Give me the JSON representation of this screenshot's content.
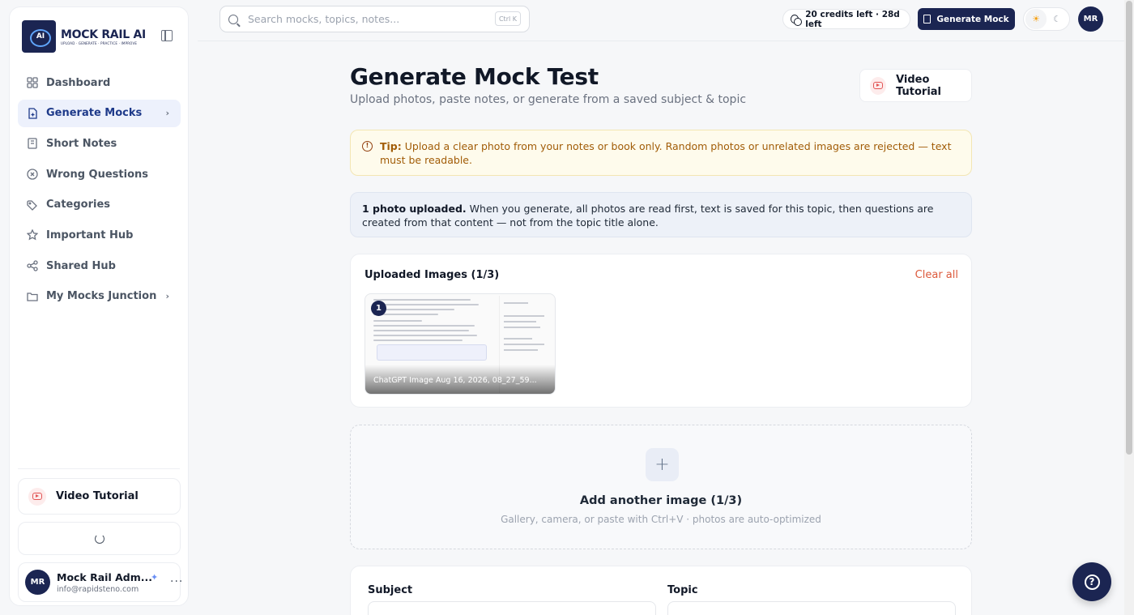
{
  "brand": {
    "title": "MOCK RAIL AI",
    "tagline": "UPLOAD · GENERATE · PRACTICE · IMPROVE"
  },
  "sidebar": {
    "items": [
      {
        "label": "Dashboard",
        "icon": "dashboard-icon"
      },
      {
        "label": "Generate Mocks",
        "icon": "file-plus-icon",
        "active": true,
        "has_chevron": true
      },
      {
        "label": "Short Notes",
        "icon": "notebook-icon"
      },
      {
        "label": "Wrong Questions",
        "icon": "x-circle-icon"
      },
      {
        "label": "Categories",
        "icon": "tags-icon"
      },
      {
        "label": "Important Hub",
        "icon": "star-icon"
      },
      {
        "label": "Shared Hub",
        "icon": "share-icon"
      },
      {
        "label": "My Mocks Junction",
        "icon": "folder-icon",
        "has_chevron": true
      }
    ],
    "video_tutorial": "Video Tutorial",
    "user": {
      "initials": "MR",
      "name": "Mock Rail Adm...",
      "email": "info@rapidsteno.com"
    }
  },
  "topbar": {
    "search_placeholder": "Search mocks, topics, notes...",
    "search_shortcut": "Ctrl K",
    "credits": "20 credits left · 28d left",
    "generate_label": "Generate Mock",
    "avatar_initials": "MR"
  },
  "main": {
    "title": "Generate Mock Test",
    "subtitle": "Upload photos, paste notes, or generate from a saved subject & topic",
    "video_tutorial": "Video Tutorial",
    "tip_label": "Tip:",
    "tip_text": " Upload a clear photo from your notes or book only. Random photos or unrelated images are rejected — text must be readable.",
    "info_bold": "1 photo uploaded.",
    "info_text": " When you generate, all photos are read first, text is saved for this topic, then questions are created from that content — not from the topic title alone.",
    "uploads_title": "Uploaded Images (1/3)",
    "clear_all": "Clear all",
    "images": [
      {
        "index": "1",
        "name": "ChatGPT Image Aug 16, 2026, 08_27_59..."
      }
    ],
    "add_title": "Add another image (1/3)",
    "add_sub": "Gallery, camera, or paste with Ctrl+V · photos are auto-optimized",
    "subject_label": "Subject",
    "topic_label": "Topic"
  },
  "colors": {
    "brand": "#1b2552",
    "accent_red": "#dc5a3c",
    "tip_bg": "#fefbec",
    "info_bg": "#edf1f8"
  }
}
